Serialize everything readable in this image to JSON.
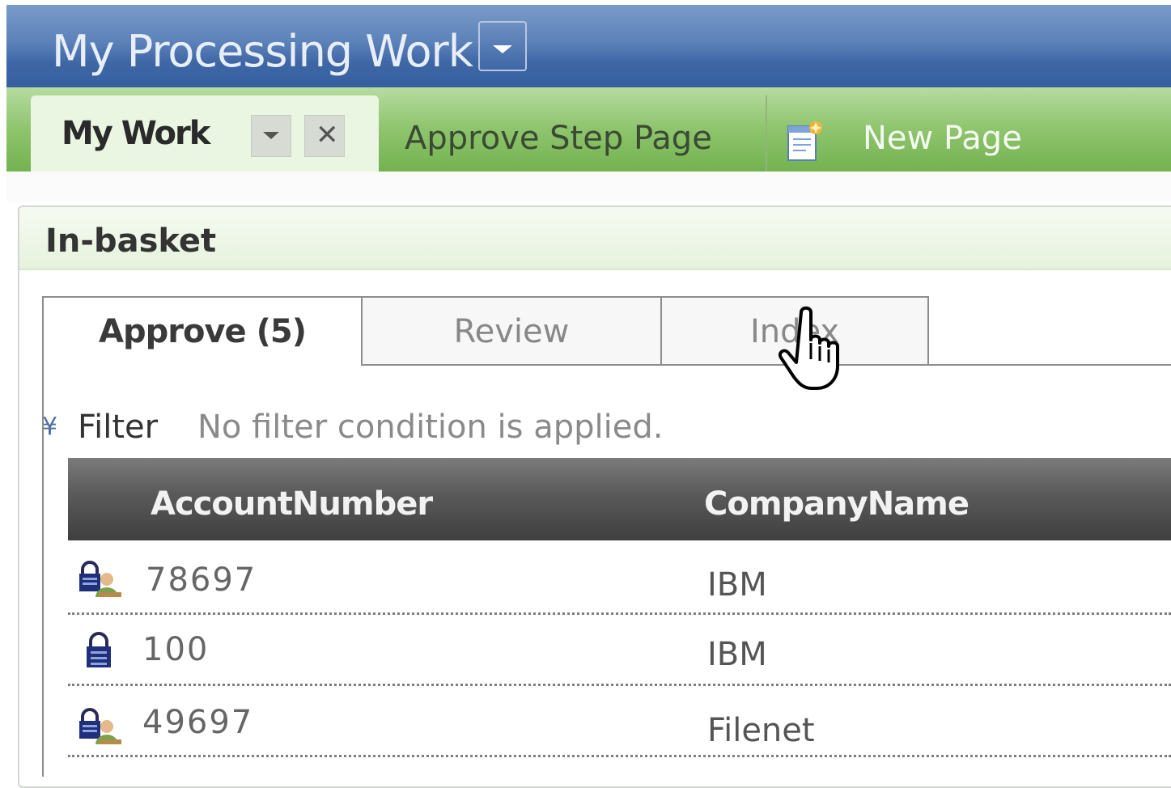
{
  "app": {
    "title": "My Processing Work"
  },
  "page_tabs": [
    {
      "label": "My Work",
      "active": true
    },
    {
      "label": "Approve Step Page",
      "active": false
    },
    {
      "label": "New Page",
      "active": false,
      "icon": "new-page-icon"
    }
  ],
  "panel": {
    "title": "In-basket"
  },
  "inbasket_tabs": [
    {
      "label": "Approve (5)",
      "active": true
    },
    {
      "label": "Review",
      "active": false
    },
    {
      "label": "Index",
      "active": false
    }
  ],
  "filter": {
    "label": "Filter",
    "status": "No filter condition is applied."
  },
  "grid": {
    "columns": [
      "AccountNumber",
      "CompanyName"
    ],
    "rows": [
      {
        "account": "78697",
        "company": "IBM",
        "icon": "locked-user-icon"
      },
      {
        "account": "100",
        "company": "IBM",
        "icon": "lock-icon"
      },
      {
        "account": "49697",
        "company": "Filenet",
        "icon": "locked-user-icon"
      }
    ]
  },
  "colors": {
    "title_bar": "#3f67a6",
    "tab_bar": "#8ec46d",
    "grid_header": "#4a4a4a"
  }
}
